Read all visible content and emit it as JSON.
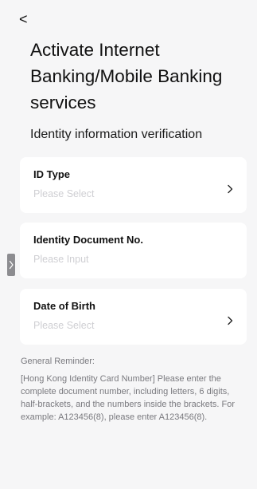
{
  "nav": {
    "back_icon": "chevron-left-icon",
    "back_glyph": "<"
  },
  "header": {
    "title": "Activate Internet Banking/Mobile Banking services",
    "subtitle": "Identity information verification"
  },
  "form": {
    "fields": [
      {
        "label": "ID Type",
        "placeholder": "Please Select",
        "has_chevron": true
      },
      {
        "label": "Identity Document No.",
        "placeholder": "Please Input",
        "has_chevron": false
      },
      {
        "label": "Date of Birth",
        "placeholder": "Please Select",
        "has_chevron": true
      }
    ]
  },
  "reminder": {
    "title": "General Reminder:",
    "text": "[Hong Kong Identity Card Number] Please enter the complete document number, including letters, 6 digits, half-brackets, and the numbers inside the brackets. For example: A123456(8), please enter A123456(8)."
  },
  "colors": {
    "background": "#f6f6f7",
    "card": "#ffffff",
    "placeholder": "#cfcfd3",
    "muted_text": "#7a7a7f"
  }
}
